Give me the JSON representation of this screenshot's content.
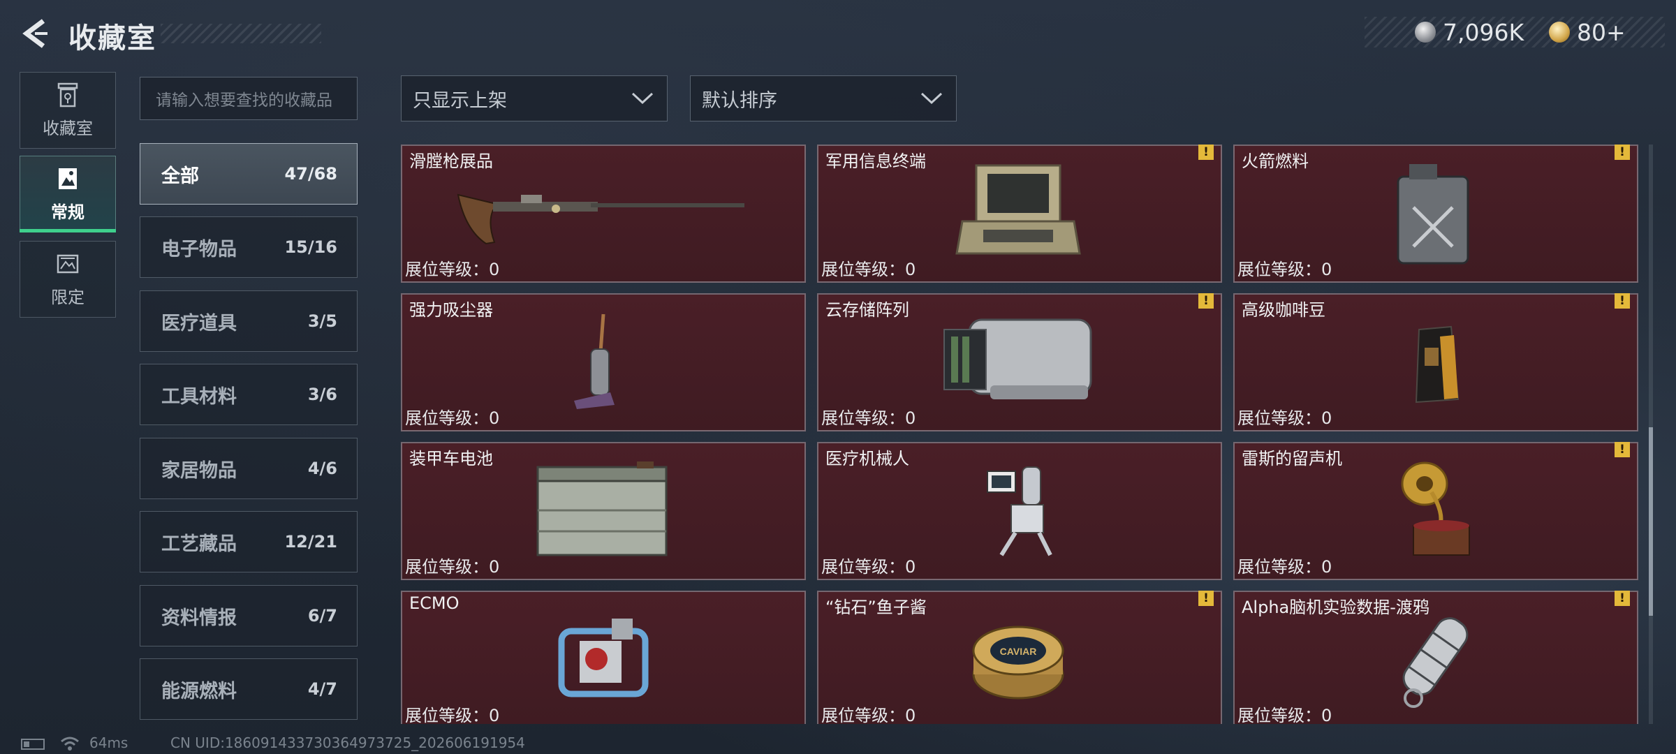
{
  "header": {
    "title": "收藏室",
    "currencies": [
      {
        "icon": "silver-coin-icon",
        "value": "7,096K"
      },
      {
        "icon": "gold-coin-icon",
        "value": "80+"
      }
    ]
  },
  "leftnav": [
    {
      "label": "收藏室",
      "icon": "trash-can-icon",
      "active": false
    },
    {
      "label": "常规",
      "icon": "picture-frame-icon",
      "active": true
    },
    {
      "label": "限定",
      "icon": "limited-frame-icon",
      "active": false
    }
  ],
  "search": {
    "placeholder": "请输入想要查找的收藏品"
  },
  "categories": [
    {
      "name": "全部",
      "count": "47/68",
      "active": true
    },
    {
      "name": "电子物品",
      "count": "15/16"
    },
    {
      "name": "医疗道具",
      "count": "3/5"
    },
    {
      "name": "工具材料",
      "count": "3/6"
    },
    {
      "name": "家居物品",
      "count": "4/6"
    },
    {
      "name": "工艺藏品",
      "count": "12/21"
    },
    {
      "name": "资料情报",
      "count": "6/7"
    },
    {
      "name": "能源燃料",
      "count": "4/7"
    }
  ],
  "filters": {
    "shelf_filter": "只显示上架",
    "sort": "默认排序"
  },
  "items": [
    {
      "name": "滑膛枪展品",
      "level": "展位等级：0",
      "warning": false,
      "icon": "musket-icon"
    },
    {
      "name": "军用信息终端",
      "level": "展位等级：0",
      "warning": true,
      "icon": "military-terminal-icon"
    },
    {
      "name": "火箭燃料",
      "level": "展位等级：0",
      "warning": true,
      "icon": "fuel-canister-icon"
    },
    {
      "name": "强力吸尘器",
      "level": "展位等级：0",
      "warning": false,
      "icon": "vacuum-cleaner-icon"
    },
    {
      "name": "云存储阵列",
      "level": "展位等级：0",
      "warning": true,
      "icon": "storage-array-icon"
    },
    {
      "name": "高级咖啡豆",
      "level": "展位等级：0",
      "warning": true,
      "icon": "coffee-bag-icon"
    },
    {
      "name": "装甲车电池",
      "level": "展位等级：0",
      "warning": false,
      "icon": "car-battery-icon"
    },
    {
      "name": "医疗机械人",
      "level": "展位等级：0",
      "warning": false,
      "icon": "medical-robot-icon"
    },
    {
      "name": "雷斯的留声机",
      "level": "展位等级：0",
      "warning": true,
      "icon": "gramophone-icon"
    },
    {
      "name": "ECMO",
      "level": "展位等级：0",
      "warning": false,
      "icon": "ecmo-machine-icon"
    },
    {
      "name": "“钻石”鱼子酱",
      "level": "展位等级：0",
      "warning": true,
      "icon": "caviar-tin-icon",
      "label_text": "CAVIAR"
    },
    {
      "name": "Alpha脑机实验数据-渡鸦",
      "level": "展位等级：0",
      "warning": true,
      "icon": "data-capsule-icon"
    }
  ],
  "warning_mark": "!",
  "footer": {
    "ping": "64ms",
    "uid": "CN UID:186091433730364973725_202606191954"
  }
}
